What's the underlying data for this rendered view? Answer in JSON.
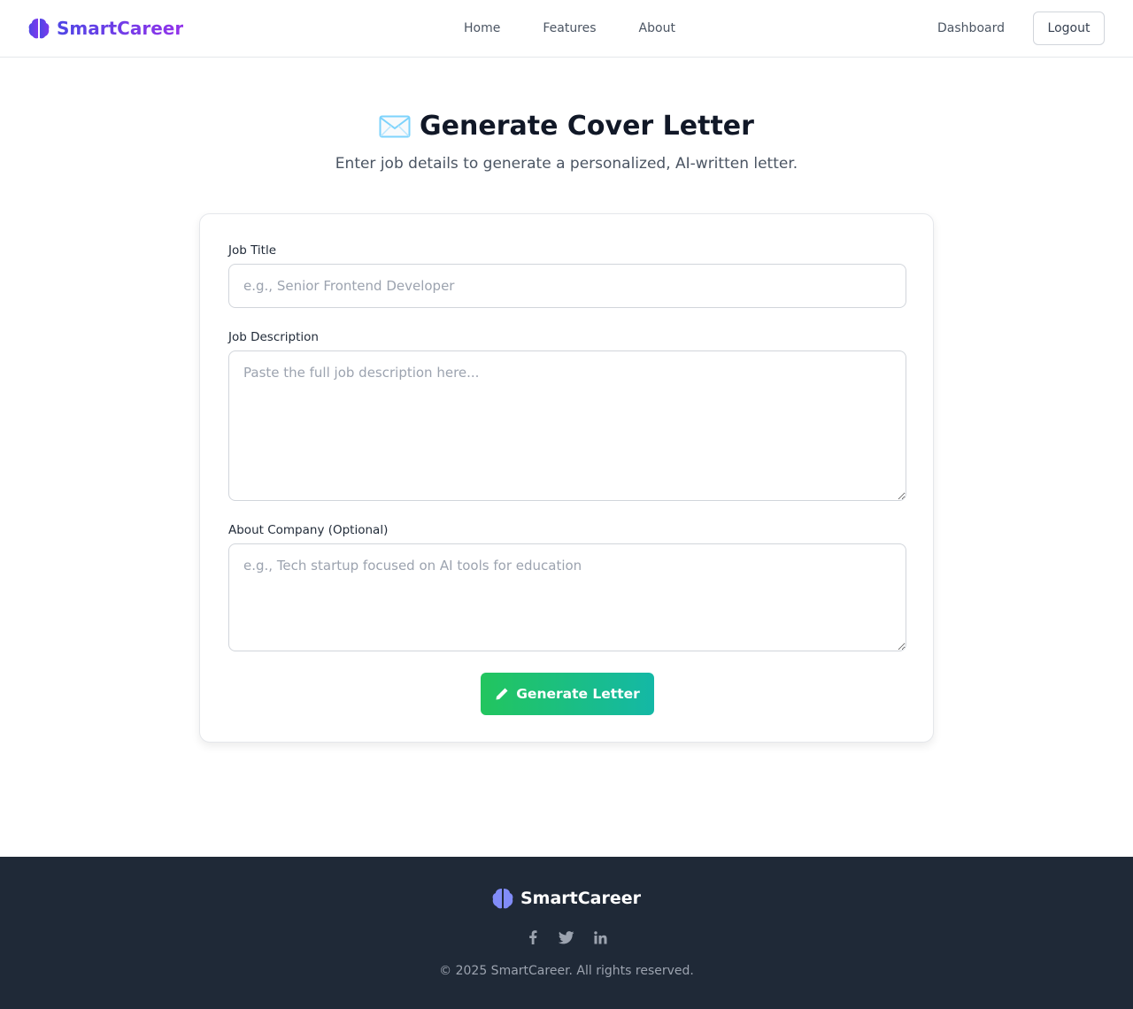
{
  "nav": {
    "brand": "SmartCareer",
    "links": [
      "Home",
      "Features",
      "About"
    ],
    "dashboard": "Dashboard",
    "logout": "Logout"
  },
  "hero": {
    "title": "Generate Cover Letter",
    "subtitle": "Enter job details to generate a personalized, AI-written letter."
  },
  "form": {
    "job_title": {
      "label": "Job Title",
      "placeholder": "e.g., Senior Frontend Developer",
      "value": ""
    },
    "job_description": {
      "label": "Job Description",
      "placeholder": "Paste the full job description here...",
      "value": ""
    },
    "about_company": {
      "label": "About Company (Optional)",
      "placeholder": "e.g., Tech startup focused on AI tools for education",
      "value": ""
    },
    "submit": "Generate Letter"
  },
  "footer": {
    "brand": "SmartCareer",
    "socials": [
      "facebook-icon",
      "twitter-icon",
      "linkedin-icon"
    ],
    "copyright": "© 2025 SmartCareer. All rights reserved."
  },
  "colors": {
    "brand_start": "#4f46e5",
    "brand_end": "#9333ea",
    "button_start": "#22c55e",
    "button_end": "#14b8a6",
    "footer_bg": "#1f2937"
  }
}
